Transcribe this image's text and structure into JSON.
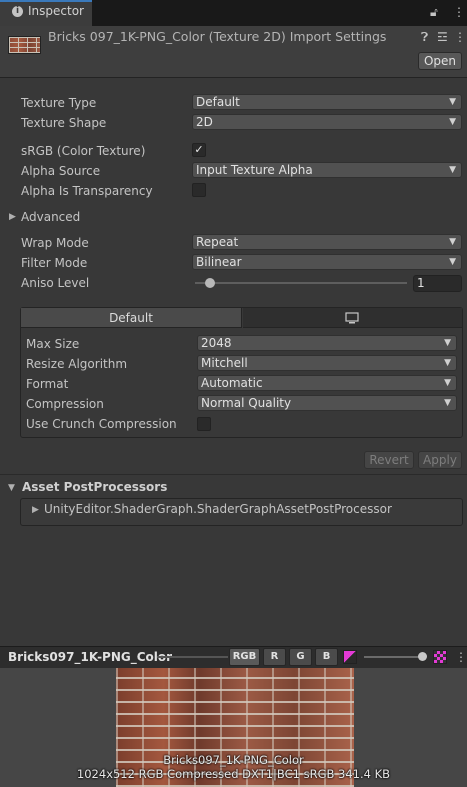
{
  "window": {
    "tab_title": "Inspector",
    "tab_icons": [
      "info-icon",
      "lock-icon",
      "more-icon"
    ]
  },
  "header": {
    "title": "Bricks 097_1K-PNG_Color (Texture 2D) Import Settings",
    "open_label": "Open",
    "icons": [
      "help-icon",
      "settings-sliders-icon",
      "more-icon"
    ]
  },
  "properties": {
    "texture_type": {
      "label": "Texture Type",
      "value": "Default"
    },
    "texture_shape": {
      "label": "Texture Shape",
      "value": "2D"
    },
    "srgb": {
      "label": "sRGB (Color Texture)",
      "checked": true
    },
    "alpha_source": {
      "label": "Alpha Source",
      "value": "Input Texture Alpha"
    },
    "alpha_transparency": {
      "label": "Alpha Is Transparency",
      "checked": false
    },
    "advanced": {
      "label": "Advanced",
      "expanded": false
    },
    "wrap_mode": {
      "label": "Wrap Mode",
      "value": "Repeat"
    },
    "filter_mode": {
      "label": "Filter Mode",
      "value": "Bilinear"
    },
    "aniso_level": {
      "label": "Aniso Level",
      "value": "1"
    }
  },
  "platform": {
    "tabs": [
      {
        "label": "Default",
        "active": true
      },
      {
        "label": "",
        "icon": "monitor-icon",
        "active": false
      }
    ],
    "max_size": {
      "label": "Max Size",
      "value": "2048"
    },
    "resize_algorithm": {
      "label": "Resize Algorithm",
      "value": "Mitchell"
    },
    "format": {
      "label": "Format",
      "value": "Automatic"
    },
    "compression": {
      "label": "Compression",
      "value": "Normal Quality"
    },
    "crunch": {
      "label": "Use Crunch Compression",
      "checked": false
    }
  },
  "actions": {
    "revert": "Revert",
    "apply": "Apply"
  },
  "post_processors": {
    "title": "Asset PostProcessors",
    "items": [
      "UnityEditor.ShaderGraph.ShaderGraphAssetPostProcessor"
    ]
  },
  "preview": {
    "title": "Bricks097_1K-PNG_Color",
    "channels": [
      "RGB",
      "R",
      "G",
      "B"
    ],
    "caption_name": "Bricks097_1K-PNG_Color",
    "caption_info": "1024x512  RGB Compressed DXT1|BC1 sRGB   341.4 KB"
  },
  "colors": {
    "accent": "#3a79bb",
    "background": "#383838"
  }
}
